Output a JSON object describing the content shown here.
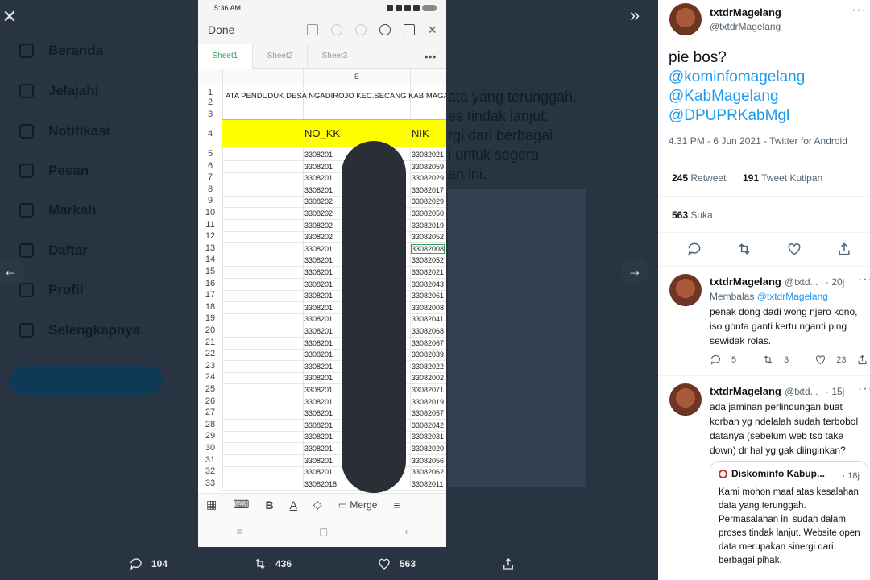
{
  "viewer": {
    "close_label": "✕",
    "expand_label": "»",
    "prev_label": "←",
    "next_label": "→",
    "actions": [
      {
        "icon": "reply-icon",
        "count": "104"
      },
      {
        "icon": "retweet-icon",
        "count": "436"
      },
      {
        "icon": "like-icon",
        "count": "563"
      },
      {
        "icon": "share-icon",
        "count": ""
      }
    ]
  },
  "background": {
    "nav": [
      "Beranda",
      "Jelajahi",
      "Notifikasi",
      "Pesan",
      "Markah",
      "Daftar",
      "Profil",
      "Selengkapnya"
    ],
    "text_fragments": [
      "ata yang terunggah.",
      "es tindak lanjut.",
      "rgi dari berbagai",
      "i untuk segera",
      "an ini."
    ]
  },
  "phone": {
    "status_time": "5:36 AM",
    "toolbar_done": "Done",
    "sheets": [
      "Sheet1",
      "Sheet2",
      "Sheet3"
    ],
    "more": "•••",
    "column_header": "E",
    "title_row": "ATA PENDUDUK DESA NGADIROJO KEC.SECANG KAB.MAGA",
    "header_no_kk": "NO_KK",
    "header_nik": "NIK",
    "row_numbers": [
      "1",
      "2",
      "3",
      "4",
      "5",
      "6",
      "7",
      "8",
      "9",
      "10",
      "11",
      "12",
      "13",
      "14",
      "15",
      "16",
      "17",
      "18",
      "19",
      "20",
      "21",
      "22",
      "23",
      "24",
      "25",
      "26",
      "27",
      "28",
      "29",
      "30",
      "31",
      "32",
      "33"
    ],
    "no_kk_values": [
      "3308201",
      "3308201",
      "3308201",
      "3308201",
      "3308202",
      "3308202",
      "3308202",
      "3308202",
      "3308201",
      "3308201",
      "3308201",
      "3308201",
      "3308201",
      "3308201",
      "3308201",
      "3308201",
      "3308201",
      "3308201",
      "3308201",
      "3308201",
      "3308201",
      "3308201",
      "3308201",
      "3308201",
      "3308201",
      "3308201",
      "3308201",
      "3308201",
      "33082018"
    ],
    "nik_values": [
      "33082021",
      "33082059",
      "33082029",
      "33082017",
      "33082029",
      "33082050",
      "33082019",
      "33082052",
      "33082008",
      "33082052",
      "33082021",
      "33082043",
      "33082061",
      "33082008",
      "33082041",
      "33082068",
      "33082067",
      "33082039",
      "33082022",
      "33082002",
      "33082071",
      "33082019",
      "33082057",
      "33082042",
      "33082031",
      "33082020",
      "33082056",
      "33082062",
      "33082011"
    ],
    "format_merge": "Merge"
  },
  "tweet": {
    "name": "txtdrMagelang",
    "handle": "@txtdrMagelang",
    "text": "pie bos?",
    "mentions": [
      "@kominfomagelang",
      "@KabMagelang",
      "@DPUPRKabMgl"
    ],
    "meta": "4.31 PM - 6 Jun 2021 - Twitter for Android",
    "retweets": "245",
    "retweets_label": "Retweet",
    "quotes": "191",
    "quotes_label": "Tweet Kutipan",
    "likes": "563",
    "likes_label": "Suka"
  },
  "replies": [
    {
      "name": "txtdrMagelang",
      "handle": "@txtd...",
      "time": "· 20j",
      "replying_prefix": "Membalas",
      "replying_to": "@txtdrMagelang",
      "text": "penak dong dadi wong njero kono, iso gonta ganti kertu nganti ping sewidak rolas.",
      "replies": "5",
      "retweets": "3",
      "likes": "23"
    },
    {
      "name": "txtdrMagelang",
      "handle": "@txtd...",
      "time": "· 15j",
      "text": "ada jaminan perlindungan buat korban yg ndelalah sudah terbobol datanya (sebelum web tsb take down) dr hal yg gak diinginkan?",
      "quote": {
        "name": "Diskominfo Kabup...",
        "time": "· 18j",
        "text": "Kami mohon maaf atas kesalahan data yang terunggah. Permasalahan ini sudah dalam proses tindak lanjut. Website open data merupakan sinergi dari berbagai pihak."
      }
    }
  ]
}
